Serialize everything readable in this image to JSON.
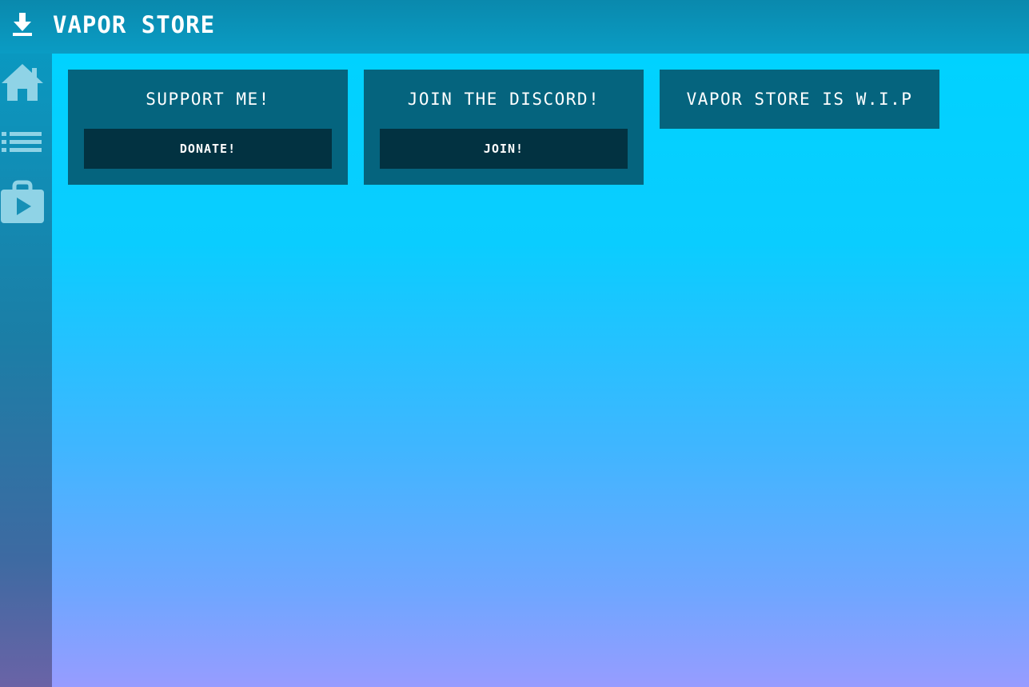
{
  "header": {
    "title": "VAPOR STORE",
    "icon": "download-icon"
  },
  "sidebar": {
    "items": [
      {
        "name": "home",
        "icon": "home-icon"
      },
      {
        "name": "list",
        "icon": "list-icon"
      },
      {
        "name": "store",
        "icon": "store-bag-icon"
      }
    ]
  },
  "cards": [
    {
      "title": "SUPPORT ME!",
      "button": "DONATE!"
    },
    {
      "title": "JOIN THE DISCORD!",
      "button": "JOIN!"
    },
    {
      "title": "VAPOR STORE IS W.I.P"
    }
  ],
  "colors": {
    "header_bg": "#0a9cc4",
    "card_bg": "#05647e",
    "button_bg": "#023241",
    "main_gradient_top": "#00d2ff",
    "main_gradient_bottom": "#979cff",
    "sidebar_icon": "#8fd3e6"
  }
}
